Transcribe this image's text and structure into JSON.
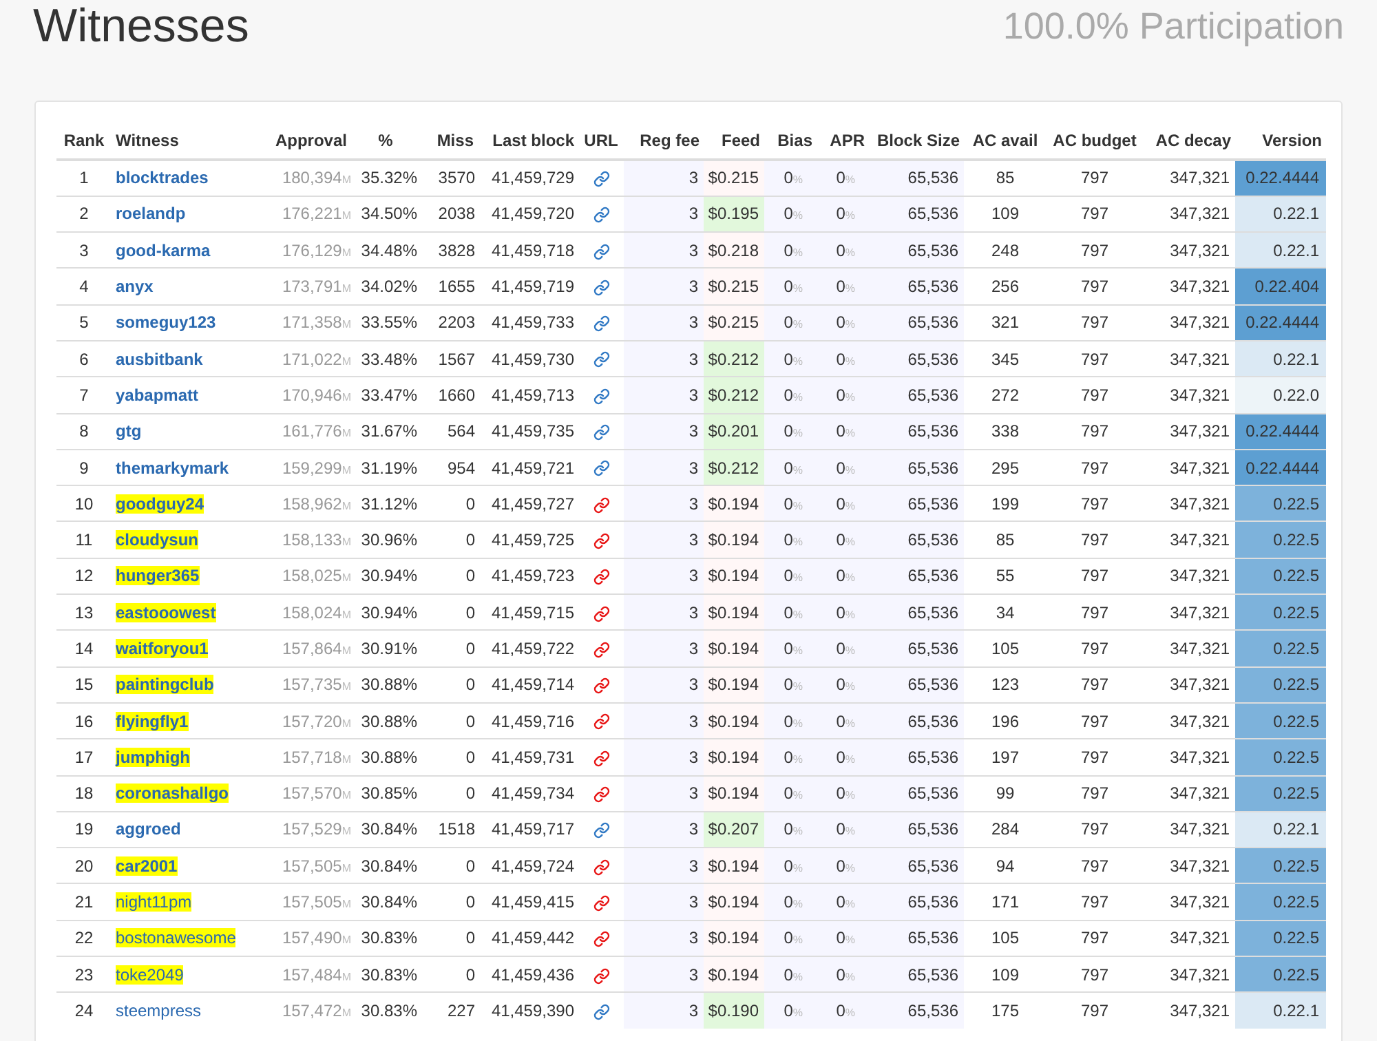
{
  "page": {
    "title": "Witnesses",
    "participation": "100.0% Participation"
  },
  "table": {
    "columns": [
      "Rank",
      "Witness",
      "Approval",
      "%",
      "Miss",
      "Last block",
      "URL",
      "Reg fee",
      "Feed",
      "Bias",
      "APR",
      "Block Size",
      "AC avail",
      "AC budget",
      "AC decay",
      "Version"
    ],
    "rows": [
      {
        "rank": "1",
        "witness": "blocktrades",
        "elected": true,
        "highlighted": false,
        "approval": "180,394",
        "approval_unit": "M",
        "percent": "35.32%",
        "miss": "3570",
        "last_block": "41,459,729",
        "url_ok": true,
        "reg_fee": "3",
        "feed": "$0.215",
        "feed_fresh": false,
        "bias": "0",
        "bias_unit": "%",
        "apr": "0",
        "apr_unit": "%",
        "block_size": "65,536",
        "ac_avail": "85",
        "ac_budget": "797",
        "ac_decay": "347,321",
        "version": "0.22.4444",
        "color": "#5d9fd2"
      },
      {
        "rank": "2",
        "witness": "roelandp",
        "elected": true,
        "highlighted": false,
        "approval": "176,221",
        "approval_unit": "M",
        "percent": "34.50%",
        "miss": "2038",
        "last_block": "41,459,720",
        "url_ok": true,
        "reg_fee": "3",
        "feed": "$0.195",
        "feed_fresh": true,
        "bias": "0",
        "bias_unit": "%",
        "apr": "0",
        "apr_unit": "%",
        "block_size": "65,536",
        "ac_avail": "109",
        "ac_budget": "797",
        "ac_decay": "347,321",
        "version": "0.22.1",
        "color": "#dbe9f4"
      },
      {
        "rank": "3",
        "witness": "good-karma",
        "elected": true,
        "highlighted": false,
        "approval": "176,129",
        "approval_unit": "M",
        "percent": "34.48%",
        "miss": "3828",
        "last_block": "41,459,718",
        "url_ok": true,
        "reg_fee": "3",
        "feed": "$0.218",
        "feed_fresh": false,
        "bias": "0",
        "bias_unit": "%",
        "apr": "0",
        "apr_unit": "%",
        "block_size": "65,536",
        "ac_avail": "248",
        "ac_budget": "797",
        "ac_decay": "347,321",
        "version": "0.22.1",
        "color": "#dbe9f4"
      },
      {
        "rank": "4",
        "witness": "anyx",
        "elected": true,
        "highlighted": false,
        "approval": "173,791",
        "approval_unit": "M",
        "percent": "34.02%",
        "miss": "1655",
        "last_block": "41,459,719",
        "url_ok": true,
        "reg_fee": "3",
        "feed": "$0.215",
        "feed_fresh": false,
        "bias": "0",
        "bias_unit": "%",
        "apr": "0",
        "apr_unit": "%",
        "block_size": "65,536",
        "ac_avail": "256",
        "ac_budget": "797",
        "ac_decay": "347,321",
        "version": "0.22.404",
        "color": "#5d9fd2"
      },
      {
        "rank": "5",
        "witness": "someguy123",
        "elected": true,
        "highlighted": false,
        "approval": "171,358",
        "approval_unit": "M",
        "percent": "33.55%",
        "miss": "2203",
        "last_block": "41,459,733",
        "url_ok": true,
        "reg_fee": "3",
        "feed": "$0.215",
        "feed_fresh": false,
        "bias": "0",
        "bias_unit": "%",
        "apr": "0",
        "apr_unit": "%",
        "block_size": "65,536",
        "ac_avail": "321",
        "ac_budget": "797",
        "ac_decay": "347,321",
        "version": "0.22.4444",
        "color": "#5d9fd2"
      },
      {
        "rank": "6",
        "witness": "ausbitbank",
        "elected": true,
        "highlighted": false,
        "approval": "171,022",
        "approval_unit": "M",
        "percent": "33.48%",
        "miss": "1567",
        "last_block": "41,459,730",
        "url_ok": true,
        "reg_fee": "3",
        "feed": "$0.212",
        "feed_fresh": true,
        "bias": "0",
        "bias_unit": "%",
        "apr": "0",
        "apr_unit": "%",
        "block_size": "65,536",
        "ac_avail": "345",
        "ac_budget": "797",
        "ac_decay": "347,321",
        "version": "0.22.1",
        "color": "#dbe9f4"
      },
      {
        "rank": "7",
        "witness": "yabapmatt",
        "elected": true,
        "highlighted": false,
        "approval": "170,946",
        "approval_unit": "M",
        "percent": "33.47%",
        "miss": "1660",
        "last_block": "41,459,713",
        "url_ok": true,
        "reg_fee": "3",
        "feed": "$0.212",
        "feed_fresh": true,
        "bias": "0",
        "bias_unit": "%",
        "apr": "0",
        "apr_unit": "%",
        "block_size": "65,536",
        "ac_avail": "272",
        "ac_budget": "797",
        "ac_decay": "347,321",
        "version": "0.22.0",
        "color": "#edf4f8"
      },
      {
        "rank": "8",
        "witness": "gtg",
        "elected": true,
        "highlighted": false,
        "approval": "161,776",
        "approval_unit": "M",
        "percent": "31.67%",
        "miss": "564",
        "last_block": "41,459,735",
        "url_ok": true,
        "reg_fee": "3",
        "feed": "$0.201",
        "feed_fresh": true,
        "bias": "0",
        "bias_unit": "%",
        "apr": "0",
        "apr_unit": "%",
        "block_size": "65,536",
        "ac_avail": "338",
        "ac_budget": "797",
        "ac_decay": "347,321",
        "version": "0.22.4444",
        "color": "#5d9fd2"
      },
      {
        "rank": "9",
        "witness": "themarkymark",
        "elected": true,
        "highlighted": false,
        "approval": "159,299",
        "approval_unit": "M",
        "percent": "31.19%",
        "miss": "954",
        "last_block": "41,459,721",
        "url_ok": true,
        "reg_fee": "3",
        "feed": "$0.212",
        "feed_fresh": true,
        "bias": "0",
        "bias_unit": "%",
        "apr": "0",
        "apr_unit": "%",
        "block_size": "65,536",
        "ac_avail": "295",
        "ac_budget": "797",
        "ac_decay": "347,321",
        "version": "0.22.4444",
        "color": "#5d9fd2"
      },
      {
        "rank": "10",
        "witness": "goodguy24",
        "elected": true,
        "highlighted": true,
        "approval": "158,962",
        "approval_unit": "M",
        "percent": "31.12%",
        "miss": "0",
        "last_block": "41,459,727",
        "url_ok": false,
        "reg_fee": "3",
        "feed": "$0.194",
        "feed_fresh": false,
        "bias": "0",
        "bias_unit": "%",
        "apr": "0",
        "apr_unit": "%",
        "block_size": "65,536",
        "ac_avail": "199",
        "ac_budget": "797",
        "ac_decay": "347,321",
        "version": "0.22.5",
        "color": "#7db2db"
      },
      {
        "rank": "11",
        "witness": "cloudysun",
        "elected": true,
        "highlighted": true,
        "approval": "158,133",
        "approval_unit": "M",
        "percent": "30.96%",
        "miss": "0",
        "last_block": "41,459,725",
        "url_ok": false,
        "reg_fee": "3",
        "feed": "$0.194",
        "feed_fresh": false,
        "bias": "0",
        "bias_unit": "%",
        "apr": "0",
        "apr_unit": "%",
        "block_size": "65,536",
        "ac_avail": "85",
        "ac_budget": "797",
        "ac_decay": "347,321",
        "version": "0.22.5",
        "color": "#7db2db"
      },
      {
        "rank": "12",
        "witness": "hunger365",
        "elected": true,
        "highlighted": true,
        "approval": "158,025",
        "approval_unit": "M",
        "percent": "30.94%",
        "miss": "0",
        "last_block": "41,459,723",
        "url_ok": false,
        "reg_fee": "3",
        "feed": "$0.194",
        "feed_fresh": false,
        "bias": "0",
        "bias_unit": "%",
        "apr": "0",
        "apr_unit": "%",
        "block_size": "65,536",
        "ac_avail": "55",
        "ac_budget": "797",
        "ac_decay": "347,321",
        "version": "0.22.5",
        "color": "#7db2db"
      },
      {
        "rank": "13",
        "witness": "eastooowest",
        "elected": true,
        "highlighted": true,
        "approval": "158,024",
        "approval_unit": "M",
        "percent": "30.94%",
        "miss": "0",
        "last_block": "41,459,715",
        "url_ok": false,
        "reg_fee": "3",
        "feed": "$0.194",
        "feed_fresh": false,
        "bias": "0",
        "bias_unit": "%",
        "apr": "0",
        "apr_unit": "%",
        "block_size": "65,536",
        "ac_avail": "34",
        "ac_budget": "797",
        "ac_decay": "347,321",
        "version": "0.22.5",
        "color": "#7db2db"
      },
      {
        "rank": "14",
        "witness": "waitforyou1",
        "elected": true,
        "highlighted": true,
        "approval": "157,864",
        "approval_unit": "M",
        "percent": "30.91%",
        "miss": "0",
        "last_block": "41,459,722",
        "url_ok": false,
        "reg_fee": "3",
        "feed": "$0.194",
        "feed_fresh": false,
        "bias": "0",
        "bias_unit": "%",
        "apr": "0",
        "apr_unit": "%",
        "block_size": "65,536",
        "ac_avail": "105",
        "ac_budget": "797",
        "ac_decay": "347,321",
        "version": "0.22.5",
        "color": "#7db2db"
      },
      {
        "rank": "15",
        "witness": "paintingclub",
        "elected": true,
        "highlighted": true,
        "approval": "157,735",
        "approval_unit": "M",
        "percent": "30.88%",
        "miss": "0",
        "last_block": "41,459,714",
        "url_ok": false,
        "reg_fee": "3",
        "feed": "$0.194",
        "feed_fresh": false,
        "bias": "0",
        "bias_unit": "%",
        "apr": "0",
        "apr_unit": "%",
        "block_size": "65,536",
        "ac_avail": "123",
        "ac_budget": "797",
        "ac_decay": "347,321",
        "version": "0.22.5",
        "color": "#7db2db"
      },
      {
        "rank": "16",
        "witness": "flyingfly1",
        "elected": true,
        "highlighted": true,
        "approval": "157,720",
        "approval_unit": "M",
        "percent": "30.88%",
        "miss": "0",
        "last_block": "41,459,716",
        "url_ok": false,
        "reg_fee": "3",
        "feed": "$0.194",
        "feed_fresh": false,
        "bias": "0",
        "bias_unit": "%",
        "apr": "0",
        "apr_unit": "%",
        "block_size": "65,536",
        "ac_avail": "196",
        "ac_budget": "797",
        "ac_decay": "347,321",
        "version": "0.22.5",
        "color": "#7db2db"
      },
      {
        "rank": "17",
        "witness": "jumphigh",
        "elected": true,
        "highlighted": true,
        "approval": "157,718",
        "approval_unit": "M",
        "percent": "30.88%",
        "miss": "0",
        "last_block": "41,459,731",
        "url_ok": false,
        "reg_fee": "3",
        "feed": "$0.194",
        "feed_fresh": false,
        "bias": "0",
        "bias_unit": "%",
        "apr": "0",
        "apr_unit": "%",
        "block_size": "65,536",
        "ac_avail": "197",
        "ac_budget": "797",
        "ac_decay": "347,321",
        "version": "0.22.5",
        "color": "#7db2db"
      },
      {
        "rank": "18",
        "witness": "coronashallgo",
        "elected": true,
        "highlighted": true,
        "approval": "157,570",
        "approval_unit": "M",
        "percent": "30.85%",
        "miss": "0",
        "last_block": "41,459,734",
        "url_ok": false,
        "reg_fee": "3",
        "feed": "$0.194",
        "feed_fresh": false,
        "bias": "0",
        "bias_unit": "%",
        "apr": "0",
        "apr_unit": "%",
        "block_size": "65,536",
        "ac_avail": "99",
        "ac_budget": "797",
        "ac_decay": "347,321",
        "version": "0.22.5",
        "color": "#7db2db"
      },
      {
        "rank": "19",
        "witness": "aggroed",
        "elected": true,
        "highlighted": false,
        "approval": "157,529",
        "approval_unit": "M",
        "percent": "30.84%",
        "miss": "1518",
        "last_block": "41,459,717",
        "url_ok": true,
        "reg_fee": "3",
        "feed": "$0.207",
        "feed_fresh": true,
        "bias": "0",
        "bias_unit": "%",
        "apr": "0",
        "apr_unit": "%",
        "block_size": "65,536",
        "ac_avail": "284",
        "ac_budget": "797",
        "ac_decay": "347,321",
        "version": "0.22.1",
        "color": "#dbe9f4"
      },
      {
        "rank": "20",
        "witness": "car2001",
        "elected": true,
        "highlighted": true,
        "approval": "157,505",
        "approval_unit": "M",
        "percent": "30.84%",
        "miss": "0",
        "last_block": "41,459,724",
        "url_ok": false,
        "reg_fee": "3",
        "feed": "$0.194",
        "feed_fresh": false,
        "bias": "0",
        "bias_unit": "%",
        "apr": "0",
        "apr_unit": "%",
        "block_size": "65,536",
        "ac_avail": "94",
        "ac_budget": "797",
        "ac_decay": "347,321",
        "version": "0.22.5",
        "color": "#7db2db"
      },
      {
        "rank": "21",
        "witness": "night11pm",
        "elected": false,
        "highlighted": true,
        "approval": "157,505",
        "approval_unit": "M",
        "percent": "30.84%",
        "miss": "0",
        "last_block": "41,459,415",
        "url_ok": false,
        "reg_fee": "3",
        "feed": "$0.194",
        "feed_fresh": false,
        "bias": "0",
        "bias_unit": "%",
        "apr": "0",
        "apr_unit": "%",
        "block_size": "65,536",
        "ac_avail": "171",
        "ac_budget": "797",
        "ac_decay": "347,321",
        "version": "0.22.5",
        "color": "#7db2db"
      },
      {
        "rank": "22",
        "witness": "bostonawesome",
        "elected": false,
        "highlighted": true,
        "approval": "157,490",
        "approval_unit": "M",
        "percent": "30.83%",
        "miss": "0",
        "last_block": "41,459,442",
        "url_ok": false,
        "reg_fee": "3",
        "feed": "$0.194",
        "feed_fresh": false,
        "bias": "0",
        "bias_unit": "%",
        "apr": "0",
        "apr_unit": "%",
        "block_size": "65,536",
        "ac_avail": "105",
        "ac_budget": "797",
        "ac_decay": "347,321",
        "version": "0.22.5",
        "color": "#7db2db"
      },
      {
        "rank": "23",
        "witness": "toke2049",
        "elected": false,
        "highlighted": true,
        "approval": "157,484",
        "approval_unit": "M",
        "percent": "30.83%",
        "miss": "0",
        "last_block": "41,459,436",
        "url_ok": false,
        "reg_fee": "3",
        "feed": "$0.194",
        "feed_fresh": false,
        "bias": "0",
        "bias_unit": "%",
        "apr": "0",
        "apr_unit": "%",
        "block_size": "65,536",
        "ac_avail": "109",
        "ac_budget": "797",
        "ac_decay": "347,321",
        "version": "0.22.5",
        "color": "#7db2db"
      },
      {
        "rank": "24",
        "witness": "steempress",
        "elected": false,
        "highlighted": false,
        "approval": "157,472",
        "approval_unit": "M",
        "percent": "30.83%",
        "miss": "227",
        "last_block": "41,459,390",
        "url_ok": true,
        "reg_fee": "3",
        "feed": "$0.190",
        "feed_fresh": true,
        "bias": "0",
        "bias_unit": "%",
        "apr": "0",
        "apr_unit": "%",
        "block_size": "65,536",
        "ac_avail": "175",
        "ac_budget": "797",
        "ac_decay": "347,321",
        "version": "0.22.1",
        "color": "#dbe9f4"
      }
    ]
  }
}
